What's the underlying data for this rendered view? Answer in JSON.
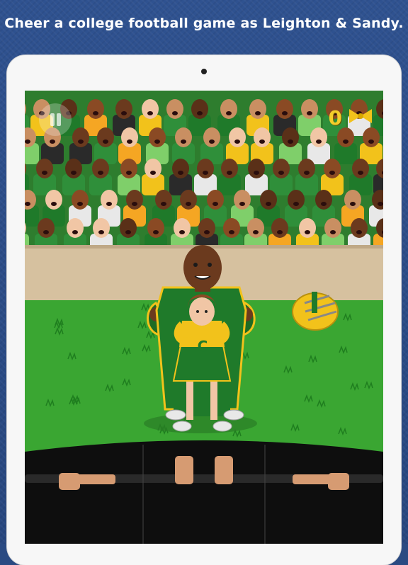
{
  "caption": "Cheer a college football game as Leighton & Sandy.",
  "hud": {
    "pause_icon": "pause-icon",
    "score": "0",
    "ribbon_icon": "yellow-bow-icon"
  },
  "characters": {
    "coach_jersey_letter": "C",
    "cheerleader_letter": "C"
  },
  "colors": {
    "background": "#2a4a82",
    "team_green": "#1f7a2a",
    "team_gold": "#f2c21b",
    "field": "#39a832",
    "wall": "#d8c3a2"
  }
}
